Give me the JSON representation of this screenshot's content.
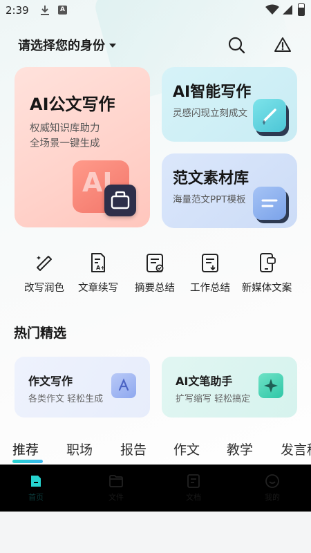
{
  "status_bar": {
    "time": "2:39",
    "app_badge": "A"
  },
  "header": {
    "identity_selector": "请选择您的身份"
  },
  "cards": {
    "main": {
      "title": "AI公文写作",
      "sub1": "权威知识库助力",
      "sub2": "全场景一键生成",
      "art_text": "AI"
    },
    "ai_writing": {
      "title": "AI智能写作",
      "sub": "灵感闪现立刻成文"
    },
    "library": {
      "title": "范文素材库",
      "sub": "海量范文PPT模板"
    }
  },
  "tools": [
    {
      "label": "改写润色",
      "icon": "magic-pen-icon"
    },
    {
      "label": "文章续写",
      "icon": "doc-continue-icon"
    },
    {
      "label": "摘要总结",
      "icon": "doc-summary-icon"
    },
    {
      "label": "工作总结",
      "icon": "doc-work-icon"
    },
    {
      "label": "新媒体文案",
      "icon": "phone-chat-icon"
    }
  ],
  "hot": {
    "title": "热门精选",
    "items": [
      {
        "title": "作文写作",
        "sub": "各类作文 轻松生成"
      },
      {
        "title": "AI文笔助手",
        "sub": "扩写缩写 轻松搞定"
      }
    ]
  },
  "tabs": [
    "推荐",
    "职场",
    "报告",
    "作文",
    "教学",
    "发言稿"
  ],
  "active_tab": "推荐",
  "colors": {
    "accent": "#26d3cf",
    "nav_bg": "#000000"
  },
  "bottom_nav": [
    {
      "icon": "home-doc-icon",
      "label": "首页"
    },
    {
      "icon": "folder-icon",
      "label": "文件"
    },
    {
      "icon": "document-icon",
      "label": "文档"
    },
    {
      "icon": "smile-icon",
      "label": "我的"
    }
  ]
}
